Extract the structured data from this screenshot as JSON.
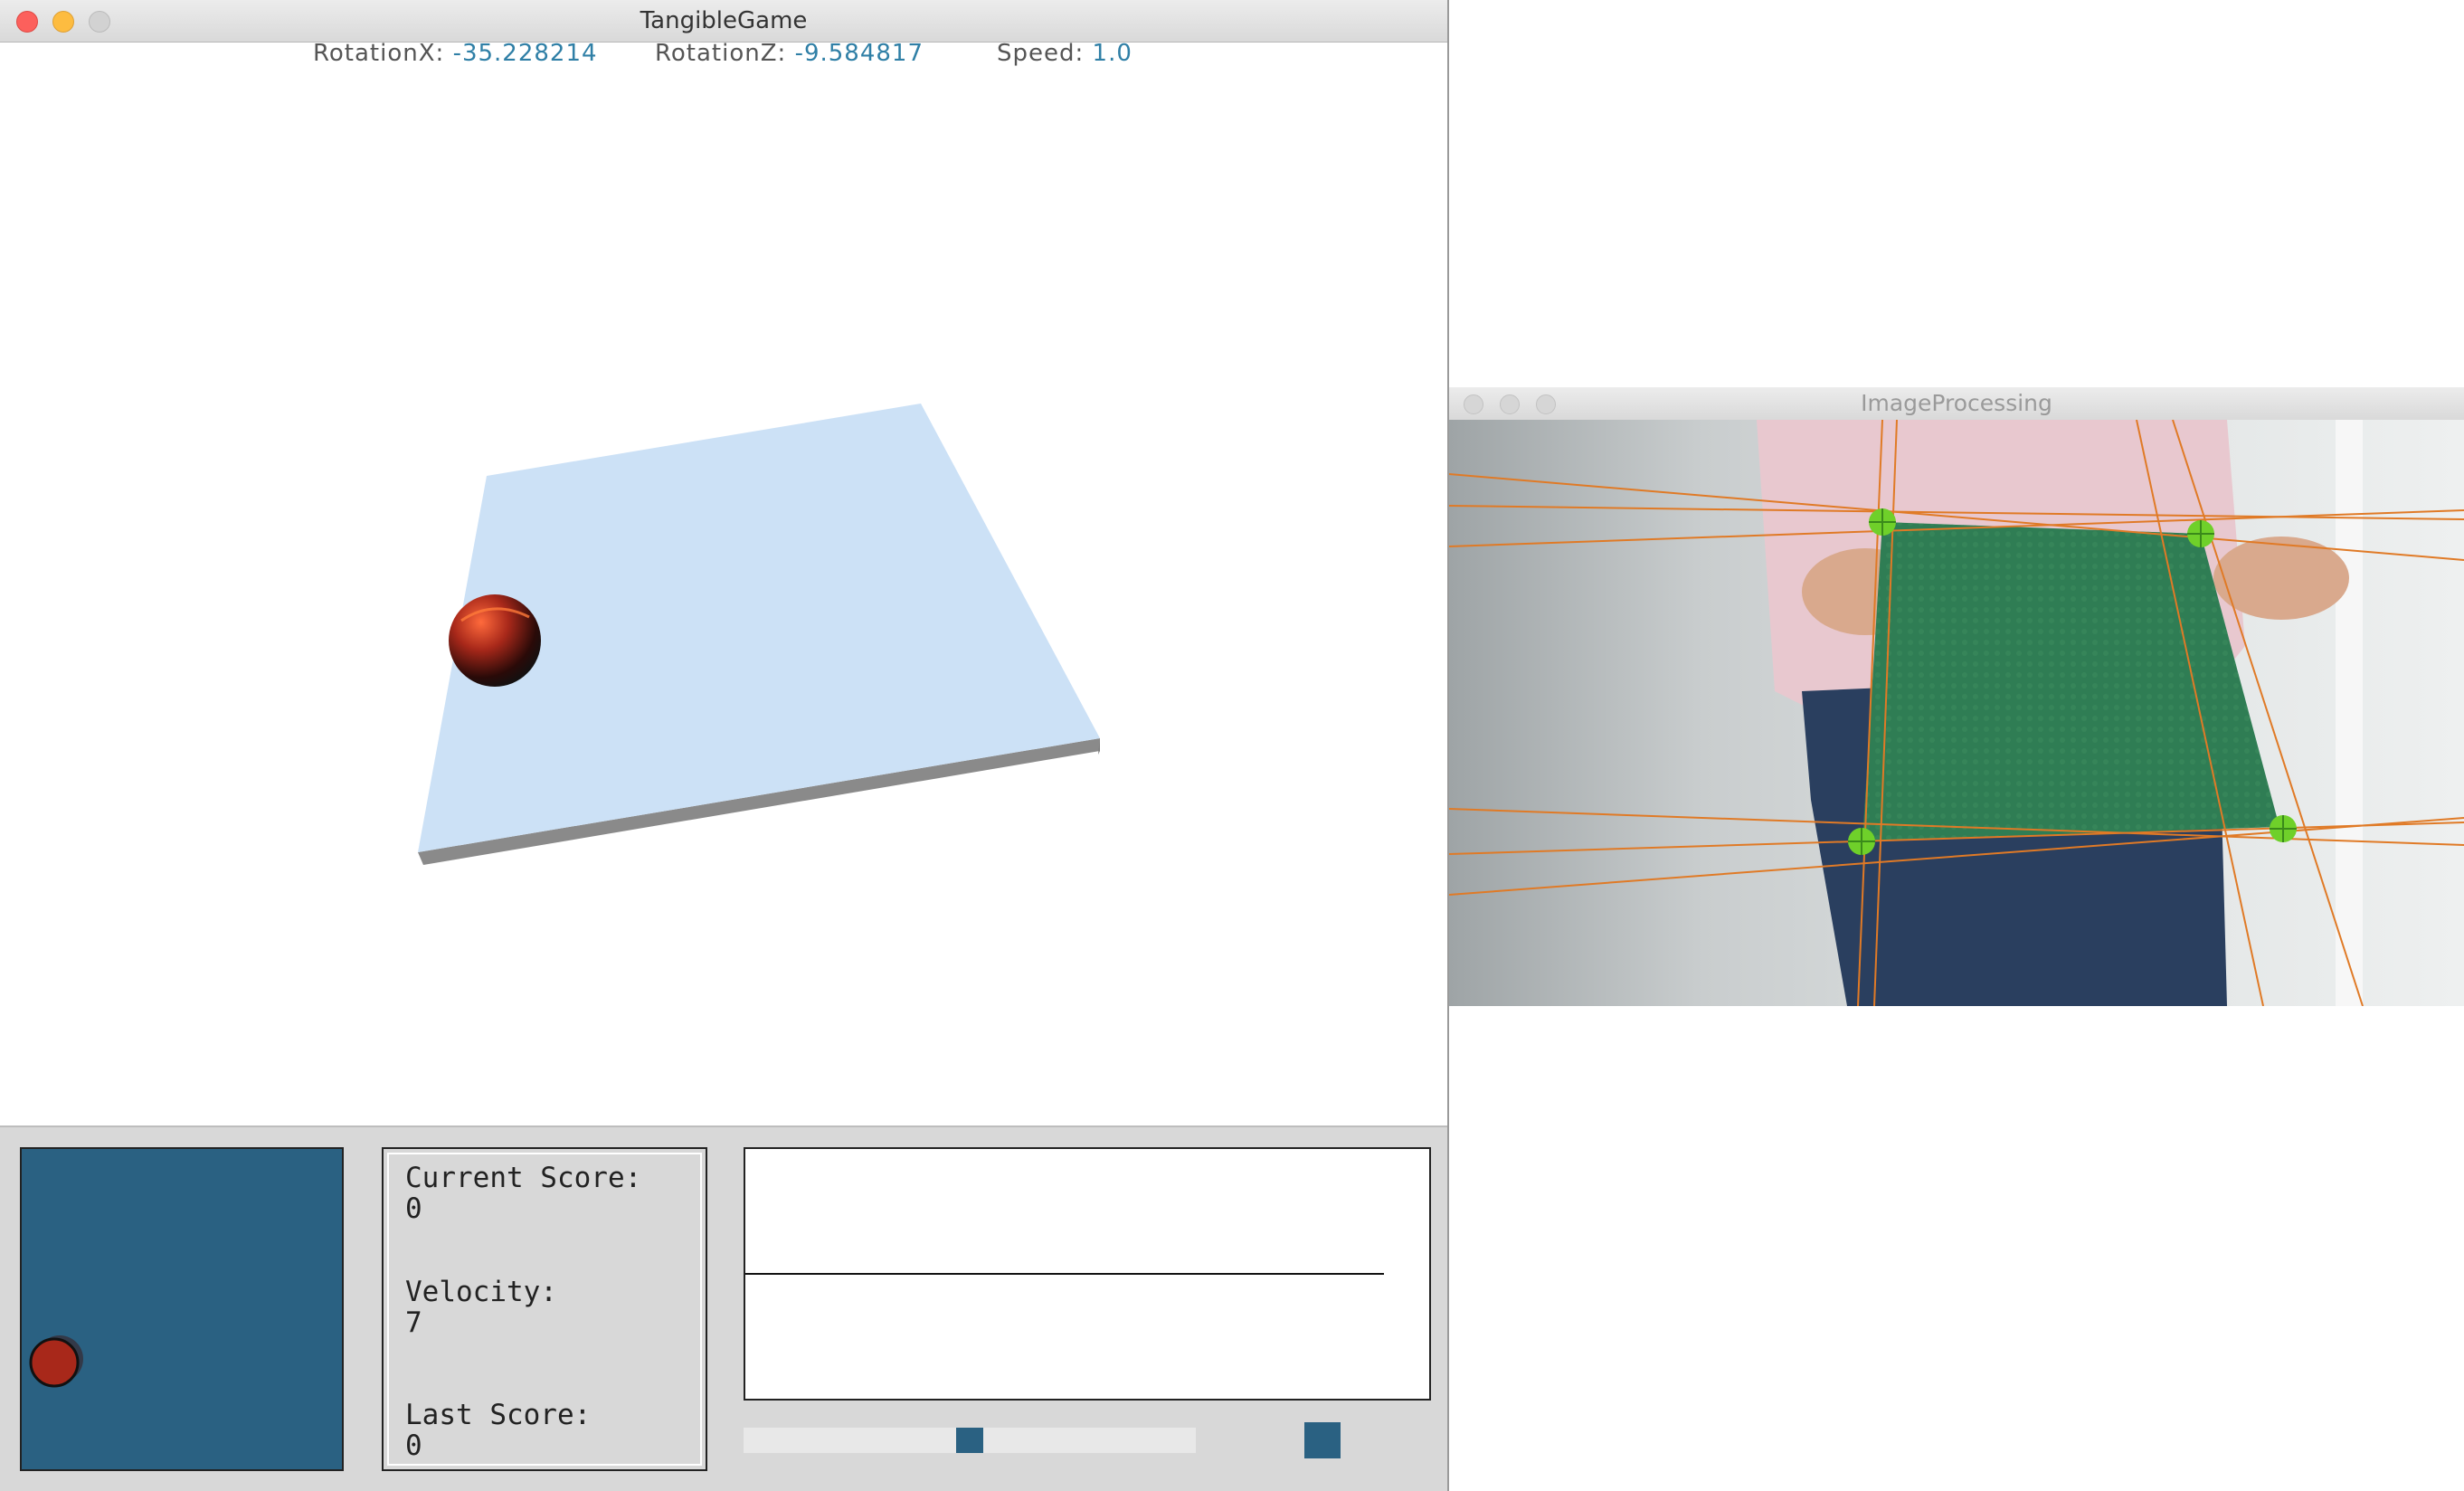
{
  "game_window": {
    "title": "TangibleGame",
    "hud": {
      "rotation_x_label": "RotationX:",
      "rotation_x_value": "-35.228214",
      "rotation_z_label": "RotationZ:",
      "rotation_z_value": "-9.584817",
      "speed_label": "Speed:",
      "speed_value": "1.0"
    },
    "score_panel": {
      "current_score_label": "Current Score:",
      "current_score_value": "0",
      "velocity_label": "Velocity:",
      "velocity_value": "7",
      "last_score_label": "Last Score:",
      "last_score_value": "0"
    },
    "scrollbar": {
      "position": 0.5
    },
    "colors": {
      "plate_top": "#cce1f6",
      "plate_side": "#8a8a8a",
      "panel_background": "#d8d8d8",
      "top_view": "#2a6182",
      "ball": "#a8281a",
      "hud_value": "#2f7fa6"
    }
  },
  "image_window": {
    "title": "ImageProcessing",
    "corner_marker_color": "#6fd02a",
    "hough_line_color": "#e07a26",
    "detected_board_color": "#2f7d54"
  }
}
